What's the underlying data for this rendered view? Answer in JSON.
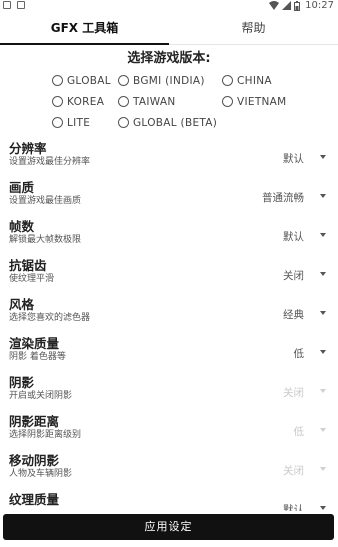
{
  "status": {
    "time": "10:27"
  },
  "tabs": [
    {
      "label": "GFX 工具箱"
    },
    {
      "label": "帮助"
    }
  ],
  "version": {
    "title": "选择游戏版本:",
    "options": [
      {
        "label": "GLOBAL"
      },
      {
        "label": "BGMI (INDIA)"
      },
      {
        "label": "CHINA"
      },
      {
        "label": "KOREA"
      },
      {
        "label": "TAIWAN"
      },
      {
        "label": "VIETNAM"
      },
      {
        "label": "LITE"
      },
      {
        "label": "GLOBAL (BETA)"
      }
    ]
  },
  "settings": [
    {
      "title": "分辨率",
      "subtitle": "设置游戏最佳分辨率",
      "value": "默认"
    },
    {
      "title": "画质",
      "subtitle": "设置游戏最佳画质",
      "value": "普通流畅"
    },
    {
      "title": "帧数",
      "subtitle": "解锁最大帧数极限",
      "value": "默认"
    },
    {
      "title": "抗锯齿",
      "subtitle": "使纹理平滑",
      "value": "关闭"
    },
    {
      "title": "风格",
      "subtitle": "选择您喜欢的滤色器",
      "value": "经典"
    },
    {
      "title": "渲染质量",
      "subtitle": "阴影 着色器等",
      "value": "低"
    },
    {
      "title": "阴影",
      "subtitle": "开启或关闭阴影",
      "value": "关闭"
    },
    {
      "title": "阴影距离",
      "subtitle": "选择阴影距离级别",
      "value": "低"
    },
    {
      "title": "移动阴影",
      "subtitle": "人物及车辆阴影",
      "value": "关闭"
    },
    {
      "title": "纹理质量",
      "subtitle": "",
      "value": "默认"
    }
  ],
  "apply_button": "应用设定"
}
